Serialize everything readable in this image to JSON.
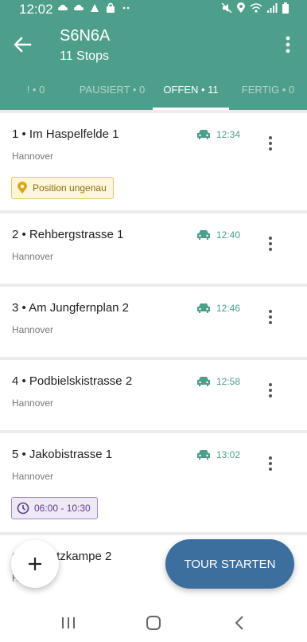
{
  "status_bar": {
    "time": "12:02",
    "left_icons": [
      "cloud-icon",
      "cloud-icon",
      "app-icon",
      "shopping-bag-icon",
      "more-dots-icon"
    ],
    "right_icons": [
      "mute-icon",
      "location-icon",
      "wifi-icon",
      "signal-icon",
      "battery-icon"
    ]
  },
  "header": {
    "title": "S6N6A",
    "subtitle": "11 Stops",
    "back_icon": "arrow-left-icon",
    "more_icon": "more-vertical-icon"
  },
  "tabs": [
    {
      "label": "! • 0",
      "active": false
    },
    {
      "label": "PAUSIERT • 0",
      "active": false
    },
    {
      "label": "OFFEN • 11",
      "active": true
    },
    {
      "label": "FERTIG • 0",
      "active": false
    }
  ],
  "stops": [
    {
      "title": "1 • Im Haspelfelde  1",
      "city": "Hannover",
      "time": "12:34",
      "badge": {
        "type": "warn",
        "text": "Position ungenau"
      }
    },
    {
      "title": "2 • Rehbergstrasse  1",
      "city": "Hannover",
      "time": "12:40",
      "badge": null
    },
    {
      "title": "3 • Am Jungfernplan  2",
      "city": "Hannover",
      "time": "12:46",
      "badge": null
    },
    {
      "title": "4 • Podbielskistrasse  2",
      "city": "Hannover",
      "time": "12:58",
      "badge": null
    },
    {
      "title": "5 • Jakobistrasse  1",
      "city": "Hannover",
      "time": "13:02",
      "badge": {
        "type": "time",
        "text": "06:00 - 10:30"
      }
    },
    {
      "title": "6 • Schatzkampe  2",
      "city": "Hannover",
      "time": "",
      "badge": null
    }
  ],
  "actions": {
    "add_label": "+",
    "start_tour_label": "TOUR STARTEN"
  },
  "colors": {
    "primary": "#4e9e8c",
    "tour_button": "#3c6e9e",
    "warn_badge": "#e8c86a",
    "time_badge": "#a48bc4"
  }
}
